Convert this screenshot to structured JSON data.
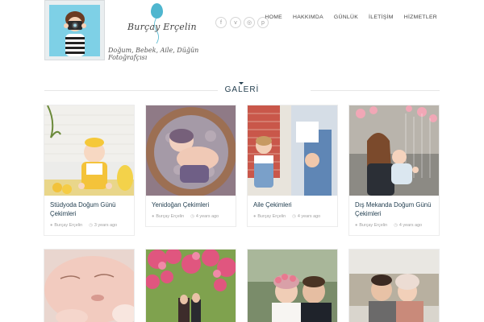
{
  "brand": {
    "name": "Burçay Erçelin",
    "tagline": "Doğum, Bebek, Aile, Düğün Fotoğrafçısı"
  },
  "social": [
    {
      "icon": "facebook-icon",
      "glyph": "f"
    },
    {
      "icon": "vimeo-icon",
      "glyph": "v"
    },
    {
      "icon": "instagram-icon",
      "glyph": "◎"
    },
    {
      "icon": "pinterest-icon",
      "glyph": "p"
    }
  ],
  "nav": [
    "HOME",
    "HAKKIMDA",
    "GÜNLÜK",
    "İLETİŞİM",
    "HİZMETLER"
  ],
  "section": {
    "title": "GALERİ"
  },
  "cards": [
    {
      "title": "Stüdyoda Doğum Günü Çekimleri",
      "author": "Burçay Erçelin",
      "date": "3 years ago"
    },
    {
      "title": "Yenidoğan Çekimleri",
      "author": "Burçay Erçelin",
      "date": "4 years ago"
    },
    {
      "title": "Aile Çekimleri",
      "author": "Burçay Erçelin",
      "date": "4 years ago"
    },
    {
      "title": "Dış Mekanda Doğum Günü Çekimleri",
      "author": "Burçay Erçelin",
      "date": "4 years ago"
    }
  ],
  "colors": {
    "accent": "#1f3a4b",
    "logo_bg": "#7ed0e6",
    "balloon": "#4fb6cf"
  }
}
